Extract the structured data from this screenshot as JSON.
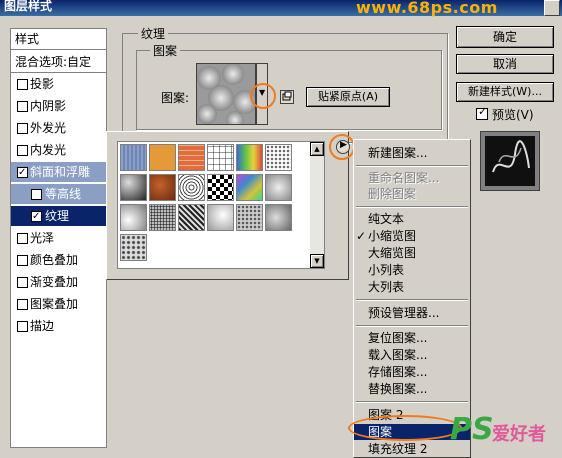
{
  "window": {
    "title": "图层样式",
    "watermark": "www.68ps.com"
  },
  "style_list": {
    "header": "样式",
    "blend_options": "混合选项:自定",
    "items": [
      {
        "label": "投影",
        "checked": false
      },
      {
        "label": "内阴影",
        "checked": false
      },
      {
        "label": "外发光",
        "checked": false
      },
      {
        "label": "内发光",
        "checked": false
      },
      {
        "label": "斜面和浮雕",
        "checked": true
      },
      {
        "label": "等高线",
        "checked": false
      },
      {
        "label": "纹理",
        "checked": true
      },
      {
        "label": "光泽",
        "checked": false
      },
      {
        "label": "颜色叠加",
        "checked": false
      },
      {
        "label": "渐变叠加",
        "checked": false
      },
      {
        "label": "图案叠加",
        "checked": false
      },
      {
        "label": "描边",
        "checked": false
      }
    ]
  },
  "buttons": {
    "ok": "确定",
    "cancel": "取消",
    "new_style": "新建样式(W)...",
    "preview": "预览(V)"
  },
  "texture": {
    "group_label": "纹理",
    "pattern_group_label": "图案",
    "pattern_label": "图案:",
    "snap_button": "贴紧原点(A)"
  },
  "menu": {
    "items": [
      {
        "label": "新建图案...",
        "disabled": false
      },
      {
        "label": "重命名图案...",
        "disabled": true
      },
      {
        "label": "删除图案",
        "disabled": true
      },
      {
        "label": "纯文本",
        "disabled": false
      },
      {
        "label": "小缩览图",
        "disabled": false,
        "checked": true
      },
      {
        "label": "大缩览图",
        "disabled": false
      },
      {
        "label": "小列表",
        "disabled": false
      },
      {
        "label": "大列表",
        "disabled": false
      },
      {
        "label": "预设管理器...",
        "disabled": false
      },
      {
        "label": "复位图案...",
        "disabled": false
      },
      {
        "label": "载入图案...",
        "disabled": false
      },
      {
        "label": "存储图案...",
        "disabled": false
      },
      {
        "label": "替换图案...",
        "disabled": false
      },
      {
        "label": "图案 2",
        "disabled": false
      },
      {
        "label": "图案",
        "disabled": false,
        "selected": true
      },
      {
        "label": "填充纹理 2",
        "disabled": false
      }
    ]
  },
  "branding": {
    "ps_logo": "PS",
    "site_name": "爱好者"
  },
  "colors": {
    "accent": "#f07a1e",
    "selection": "#0a246a",
    "watermark": "#ffb200"
  }
}
